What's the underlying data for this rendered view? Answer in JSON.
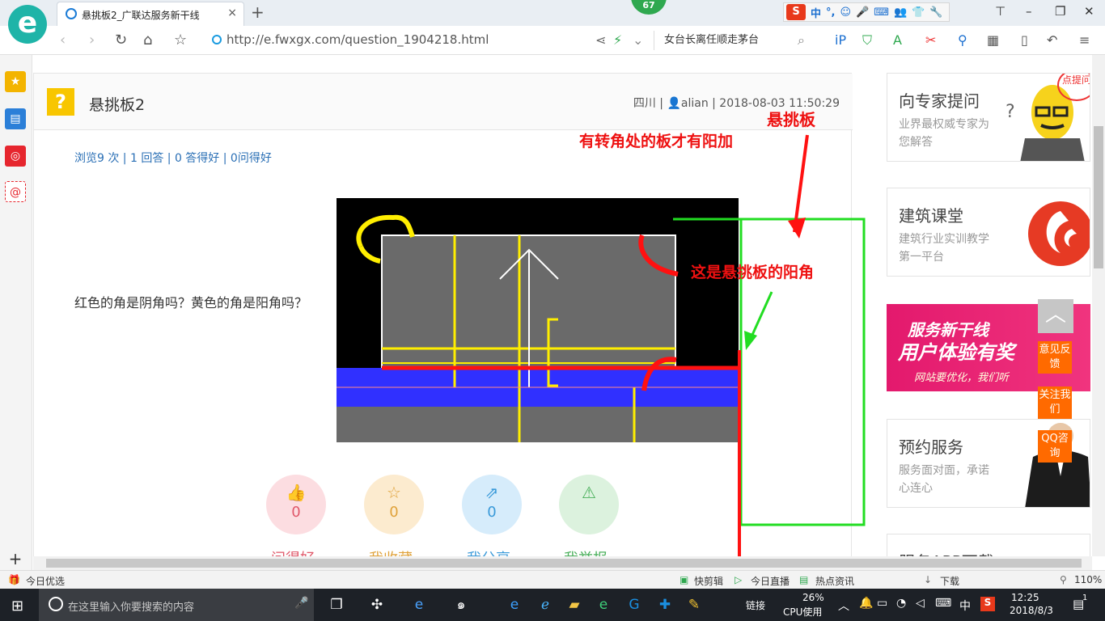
{
  "browser": {
    "tab_title": "悬挑板2_广联达服务新干线",
    "tab_close": "×",
    "new_tab": "+",
    "badge": "67",
    "url": "http://e.fwxgx.com/question_1904218.html",
    "search_text": "女台长离任顺走茅台",
    "window_controls": [
      "⊤",
      "–",
      "❐",
      "✕"
    ],
    "sogou_items": [
      "S",
      "中",
      "°,",
      "☺",
      "🎤",
      "⌨",
      "👥",
      "👕",
      "🔧"
    ]
  },
  "sidebar": {
    "items": [
      "★",
      "▤",
      "◎",
      "@"
    ],
    "add": "+"
  },
  "question": {
    "title": "悬挑板2",
    "icon": "?",
    "meta": "四川 | 👤alian | 2018-08-03 11:50:29",
    "stats": "浏览9 次 | 1 回答 | 0 答得好 | 0问得好",
    "text": "红色的角是阴角吗？黄色的角是阳角吗？",
    "annotations": {
      "a1": "悬挑板",
      "a2": "有转角处的板才有阳加",
      "a3": "这是悬挑板的阳角"
    }
  },
  "actions": [
    {
      "label": "问得好",
      "count": "0",
      "icon": "👍",
      "color": "#e0586a",
      "bg": "#fcdde1"
    },
    {
      "label": "我收藏",
      "count": "0",
      "icon": "☆",
      "color": "#e0a23a",
      "bg": "#fcebcf"
    },
    {
      "label": "我分享",
      "count": "0",
      "icon": "⇗",
      "color": "#3a9ad9",
      "bg": "#d6ecfb"
    },
    {
      "label": "我举报",
      "count": "",
      "icon": "⚠",
      "color": "#4bb05c",
      "bg": "#dcf2de"
    }
  ],
  "right": {
    "expert_title": "向专家提问",
    "expert_desc": "业界最权威专家为您解答",
    "course_title": "建筑课堂",
    "course_desc": "建筑行业实训教学第一平台",
    "promo_brand": "服务新干线",
    "promo_title": "用户体验有奖",
    "promo_sub": "网站要优化，我们听",
    "booking_title": "预约服务",
    "booking_desc": "服务面对面，承诺心连心",
    "app_title": "服务APP下载",
    "corner": "点提问",
    "feedback": "意见反馈",
    "follow": "关注我们",
    "qq": "QQ咨询",
    "to_top": "︿"
  },
  "statusbar": {
    "left": "今日优选",
    "items": [
      "快剪辑",
      "今日直播",
      "热点资讯",
      "下载",
      "110%"
    ]
  },
  "taskbar": {
    "search_placeholder": "在这里输入你要搜索的内容",
    "link_label": "链接",
    "cpu": "26%",
    "cpu_label": "CPU使用",
    "ime": "中",
    "time": "12:25",
    "date": "2018/8/3",
    "notif_count": "1"
  },
  "colors": {
    "accent_green": "#1fb4a8",
    "link_blue": "#2a6fb5",
    "orange": "#ff6a00",
    "annotation_red": "#ee1111",
    "annotation_green": "#22dd22"
  }
}
